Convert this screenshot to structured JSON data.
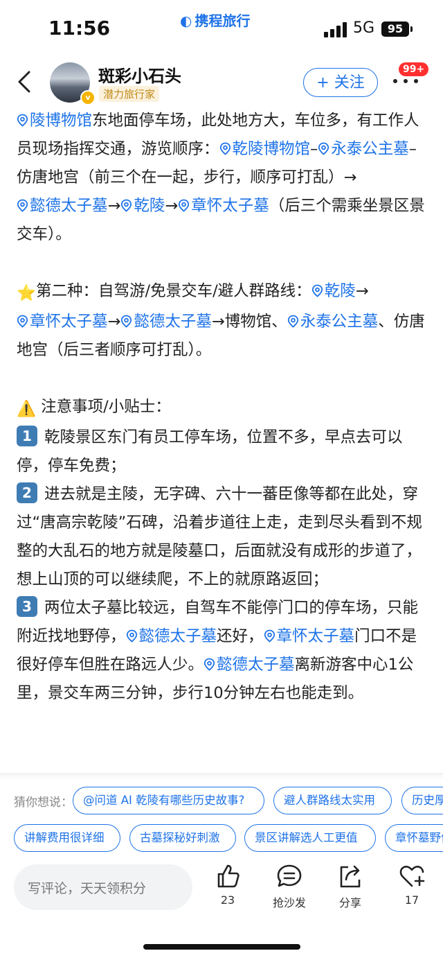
{
  "status": {
    "time": "11:56",
    "network": "5G",
    "battery": "95",
    "brand": "携程旅行"
  },
  "header": {
    "username": "斑彩小石头",
    "tag": "潜力旅行家",
    "follow_label": "+ 关注",
    "notification_badge": "99+"
  },
  "content": {
    "para1": [
      {
        "t": "loc",
        "v": "陵博物馆"
      },
      {
        "t": "text",
        "v": "东地面停车场，此处地方大，车位多，有工作人员现场指挥交通，游览顺序："
      },
      {
        "t": "loc",
        "v": "乾陵博物馆"
      },
      {
        "t": "text",
        "v": "–"
      },
      {
        "t": "loc",
        "v": "永泰公主墓"
      },
      {
        "t": "text",
        "v": "–仿唐地宫（前三个在一起，步行，顺序可打乱）→"
      },
      {
        "t": "loc",
        "v": "懿德太子墓"
      },
      {
        "t": "text",
        "v": "→"
      },
      {
        "t": "loc",
        "v": "乾陵"
      },
      {
        "t": "text",
        "v": "→"
      },
      {
        "t": "loc",
        "v": "章怀太子墓"
      },
      {
        "t": "text",
        "v": "（后三个需乘坐景区景交车）。"
      }
    ],
    "para2": [
      {
        "t": "emoji",
        "v": "⭐"
      },
      {
        "t": "text",
        "v": "第二种：自驾游/免景交车/避人群路线："
      },
      {
        "t": "loc",
        "v": "乾陵"
      },
      {
        "t": "text",
        "v": "→"
      },
      {
        "t": "loc",
        "v": "章怀太子墓"
      },
      {
        "t": "text",
        "v": "→"
      },
      {
        "t": "loc",
        "v": "懿德太子墓"
      },
      {
        "t": "text",
        "v": "→博物馆、"
      },
      {
        "t": "loc",
        "v": "永泰公主墓"
      },
      {
        "t": "text",
        "v": "、仿唐地宫（后三者顺序可打乱）。"
      }
    ],
    "para3": [
      {
        "t": "emoji",
        "v": "⚠️"
      },
      {
        "t": "text",
        "v": " 注意事项/小贴士："
      }
    ],
    "para4": [
      {
        "t": "key",
        "v": "1"
      },
      {
        "t": "text",
        "v": "乾陵景区东门有员工停车场，位置不多，早点去可以停，停车免费；"
      }
    ],
    "para5": [
      {
        "t": "key",
        "v": "2"
      },
      {
        "t": "text",
        "v": "进去就是主陵，无字碑、六十一蕃臣像等都在此处，穿过“唐高宗乾陵”石碑，沿着步道往上走，走到尽头看到不规整的大乱石的地方就是陵墓口，后面就没有成形的步道了，想上山顶的可以继续爬，不上的就原路返回；"
      }
    ],
    "para6": [
      {
        "t": "key",
        "v": "3"
      },
      {
        "t": "text",
        "v": "两位太子墓比较远，自驾车不能停门口的停车场，只能附近找地野停，"
      },
      {
        "t": "loc",
        "v": "懿德太子墓"
      },
      {
        "t": "text",
        "v": "还好，"
      },
      {
        "t": "loc",
        "v": "章怀太子墓"
      },
      {
        "t": "text",
        "v": "门口不是很好停车但胜在路远人少。"
      },
      {
        "t": "loc",
        "v": "懿德太子墓"
      },
      {
        "t": "text",
        "v": "离新游客中心1公里，景交车两三分钟，步行10分钟左右也能走到。"
      }
    ]
  },
  "suggestions": {
    "label": "猜你想说：",
    "row1": [
      "@问道 AI 乾陵有哪些历史故事?",
      "避人群路线太实用",
      "历史厚重"
    ],
    "row2": [
      "讲解费用很详细",
      "古墓探秘好刺激",
      "景区讲解选人工更值",
      "章怀墓野停"
    ]
  },
  "bottom_bar": {
    "comment_placeholder": "写评论，天天领积分",
    "like_count": "23",
    "sofa_label": "抢沙发",
    "share_label": "分享",
    "favorite_count": "17"
  },
  "icons": [
    "back-icon",
    "location-pin-icon",
    "like-icon",
    "comment-icon",
    "share-icon",
    "favorite-icon",
    "more-icon"
  ],
  "colors": {
    "accent": "#1e73e8",
    "badge": "#ff2f2f",
    "keycap": "#3f7cb4"
  }
}
